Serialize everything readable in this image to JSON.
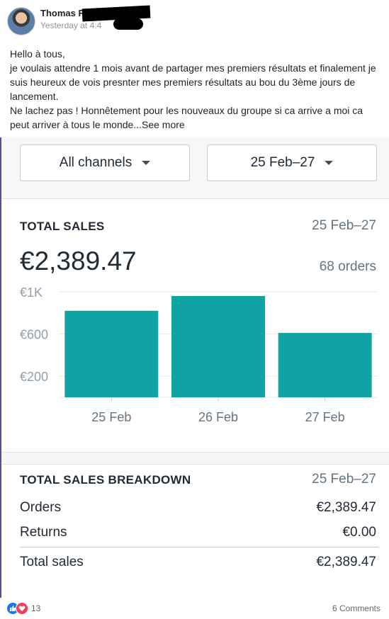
{
  "post": {
    "author": "Thomas R",
    "timestamp": "Yesterday at 4:4",
    "body_lines": [
      "Hello à tous,",
      "je voulais attendre 1 mois avant de partager mes premiers résultats et finalement je suis heureux de vois presnter mes premiers résultats au bou du 3ème jours de lancement.",
      "Ne lachez pas ! Honnêtement pour les nouveaux du groupe si ca arrive a moi ca peut arriver à tous le monde..."
    ],
    "see_more": "See more",
    "reaction_count": "13",
    "comments": "6 Comments",
    "colors": {
      "like": "#1877f2",
      "love": "#f33e58"
    }
  },
  "filters": {
    "channel": "All channels",
    "date_range": "25 Feb–27"
  },
  "total_sales": {
    "title": "TOTAL SALES",
    "date_range": "25 Feb–27",
    "amount": "€2,389.47",
    "orders": "68 orders"
  },
  "chart_data": {
    "type": "bar",
    "categories": [
      "25 Feb",
      "26 Feb",
      "27 Feb"
    ],
    "values": [
      820,
      960,
      610
    ],
    "y_tick_labels": [
      "€1K",
      "€600",
      "€200"
    ],
    "y_ticks": [
      1000,
      600,
      200
    ],
    "ylim": [
      0,
      1000
    ],
    "grid": true,
    "bar_color": "#10a3a3"
  },
  "breakdown": {
    "title": "TOTAL SALES BREAKDOWN",
    "date_range": "25 Feb–27",
    "rows": [
      {
        "label": "Orders",
        "value": "€2,389.47"
      },
      {
        "label": "Returns",
        "value": "€0.00"
      }
    ],
    "total": {
      "label": "Total sales",
      "value": "€2,389.47"
    }
  }
}
